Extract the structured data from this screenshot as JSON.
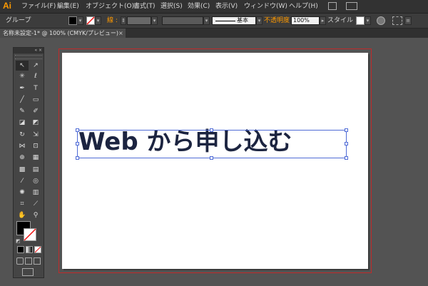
{
  "app": {
    "logo_text": "Ai"
  },
  "menu": [
    "ファイル(F)",
    "編集(E)",
    "オブジェクト(O)",
    "書式(T)",
    "選択(S)",
    "効果(C)",
    "表示(V)",
    "ウィンドウ(W)",
    "ヘルプ(H)"
  ],
  "control_bar": {
    "selection_type": "グループ",
    "stroke_label": "線 :",
    "brush_label": "基本",
    "opacity_label": "不透明度 :",
    "opacity_value": "100%",
    "style_label": "スタイル :"
  },
  "document": {
    "tab_label": "名称未設定-1* @ 100% (CMYK/プレビュー)",
    "close_glyph": "×"
  },
  "tools_panel": {
    "header_glyphs": "« ×"
  },
  "canvas": {
    "text": "Web から申し込む"
  },
  "colors": {
    "accent_orange": "#ff9a00",
    "artboard_border": "#c12a2a",
    "selection_blue": "#4f6bd6",
    "text_color": "#1c2440"
  }
}
